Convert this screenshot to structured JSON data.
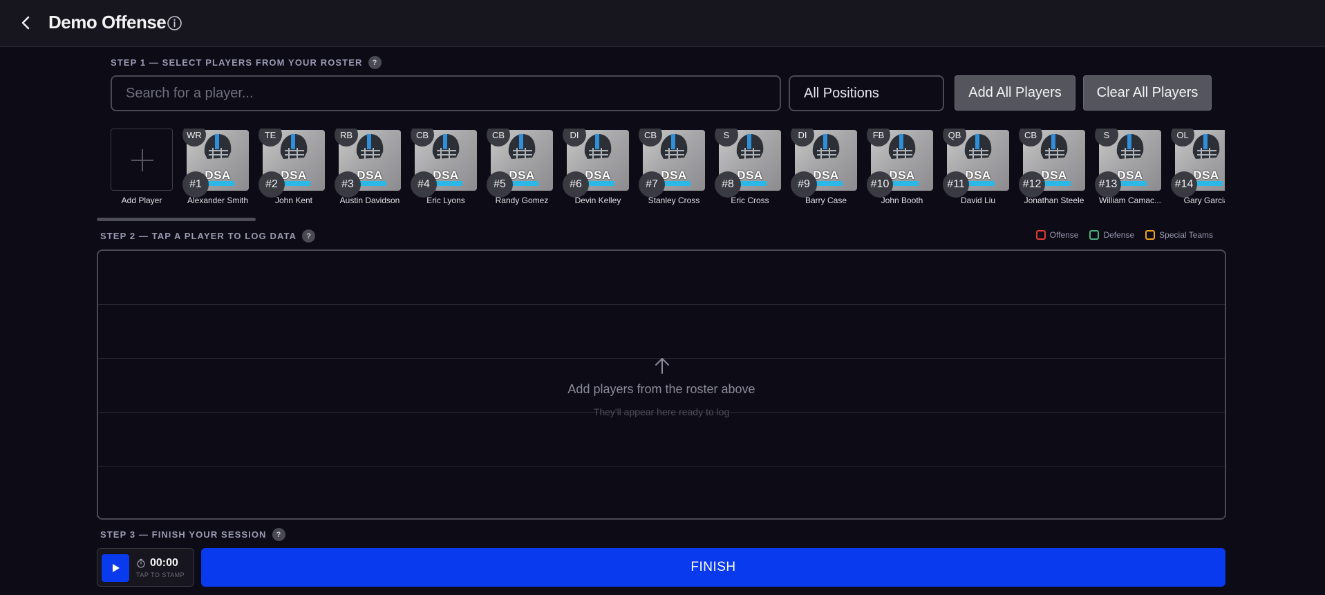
{
  "header": {
    "title": "Demo Offense",
    "back_icon": "chevron-left-icon",
    "info_icon": "info-icon"
  },
  "step1": {
    "label": "STEP 1 — SELECT PLAYERS FROM YOUR ROSTER",
    "help": "?",
    "search_placeholder": "Search for a player...",
    "search_value": "",
    "position_filter": "All Positions",
    "add_all_label": "Add All Players",
    "clear_all_label": "Clear All Players"
  },
  "roster": {
    "add_player_label": "Add Player",
    "photo_text": "DSA",
    "players": [
      {
        "pos": "WR",
        "num": "#1",
        "name": "Alexander Smith"
      },
      {
        "pos": "TE",
        "num": "#2",
        "name": "John Kent"
      },
      {
        "pos": "RB",
        "num": "#3",
        "name": "Austin Davidson"
      },
      {
        "pos": "CB",
        "num": "#4",
        "name": "Eric Lyons"
      },
      {
        "pos": "CB",
        "num": "#5",
        "name": "Randy Gomez"
      },
      {
        "pos": "DI",
        "num": "#6",
        "name": "Devin Kelley"
      },
      {
        "pos": "CB",
        "num": "#7",
        "name": "Stanley Cross"
      },
      {
        "pos": "S",
        "num": "#8",
        "name": "Eric Cross"
      },
      {
        "pos": "DI",
        "num": "#9",
        "name": "Barry Case"
      },
      {
        "pos": "FB",
        "num": "#10",
        "name": "John Booth"
      },
      {
        "pos": "QB",
        "num": "#11",
        "name": "David Liu"
      },
      {
        "pos": "CB",
        "num": "#12",
        "name": "Jonathan Steele"
      },
      {
        "pos": "S",
        "num": "#13",
        "name": "William Camac..."
      },
      {
        "pos": "OL",
        "num": "#14",
        "name": "Gary Garcia"
      }
    ]
  },
  "step2": {
    "label": "STEP 2 — TAP A PLAYER TO LOG DATA",
    "help": "?",
    "legend": [
      {
        "label": "Offense",
        "color": "#e53935"
      },
      {
        "label": "Defense",
        "color": "#4caf7d"
      },
      {
        "label": "Special Teams",
        "color": "#f0a020"
      }
    ],
    "empty_title": "Add players from the roster above",
    "empty_subtitle": "They'll appear here ready to log"
  },
  "step3": {
    "label": "STEP 3 — FINISH YOUR SESSION",
    "help": "?",
    "timer_value": "00:00",
    "timer_hint": "TAP TO STAMP",
    "finish_label": "FINISH"
  },
  "colors": {
    "accent": "#0a3aee",
    "background": "#0d0b15"
  }
}
